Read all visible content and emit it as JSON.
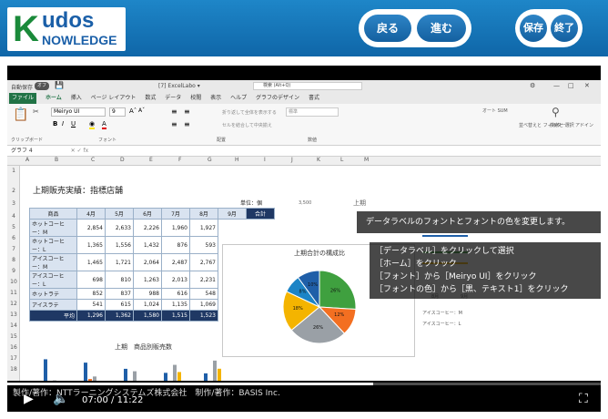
{
  "header": {
    "logo": {
      "k": "K",
      "udos": "udos",
      "nowledge": "NOWLEDGE"
    },
    "back_label": "戻る",
    "next_label": "進む",
    "save_label": "保存",
    "end_label": "終了"
  },
  "excel": {
    "autosave": "自動保存",
    "autosave_state": "オフ",
    "filename": "[7] ExcelLabo ▾",
    "search_placeholder": "検索 (Alt+Q)",
    "tabs": [
      "ファイル",
      "ホーム",
      "挿入",
      "ページ レイアウト",
      "数式",
      "データ",
      "校閲",
      "表示",
      "ヘルプ",
      "グラフのデザイン",
      "書式"
    ],
    "active_tab": "ホーム",
    "font_name": "Meiryo UI",
    "font_size": "9",
    "ribbon_groups": [
      "クリップボード",
      "フォント",
      "配置",
      "数値"
    ],
    "ribbon_items": [
      "折り返して全体を表示する",
      "セルを結合して中央揃え",
      "標準",
      "オート SUM",
      "並べ替えと フィルター",
      "検索と 選択",
      "アドイン"
    ],
    "namebox": "グラフ 4",
    "columns": [
      "A",
      "B",
      "C",
      "D",
      "E",
      "F",
      "G",
      "H",
      "I",
      "J",
      "K",
      "L",
      "M"
    ],
    "rows": [
      "1",
      "2",
      "3",
      "4",
      "5",
      "6",
      "7",
      "8",
      "9",
      "10",
      "11",
      "12",
      "13",
      "14",
      "15",
      "16",
      "17",
      "18"
    ],
    "sheet_title": "上期販売実績：指標店舗",
    "unit": "単位：個",
    "table_headers": [
      "商品",
      "4月",
      "5月",
      "6月",
      "7月",
      "8月",
      "9月",
      "合計"
    ],
    "table_rows": [
      [
        "ホットコーヒー：M",
        "2,854",
        "2,633",
        "2,226",
        "1,960",
        "1,927"
      ],
      [
        "ホットコーヒー：L",
        "1,365",
        "1,556",
        "1,432",
        "876",
        "593"
      ],
      [
        "アイスコーヒー：M",
        "1,465",
        "1,721",
        "2,064",
        "2,487",
        "2,767"
      ],
      [
        "アイスコーヒー：L",
        "698",
        "810",
        "1,263",
        "2,013",
        "2,231"
      ],
      [
        "ホットラテ",
        "852",
        "837",
        "988",
        "616",
        "548"
      ],
      [
        "アイスラテ",
        "541",
        "615",
        "1,024",
        "1,135",
        "1,069"
      ]
    ],
    "avg_row": [
      "平均",
      "1,296",
      "1,362",
      "1,580",
      "1,515",
      "1,523"
    ],
    "pie_title": "上期合計の構成比",
    "pie_labels": [
      {
        "name": "アイスラテ",
        "pct": "10%"
      },
      {
        "name": "ホットラテ",
        "pct": "8%"
      },
      {
        "name": "アイスコーヒー：L",
        "pct": "18%"
      },
      {
        "name": "アイスコーヒー：M",
        "pct": "26%"
      },
      {
        "name": "ホットコーヒー：L",
        "pct": "12%"
      },
      {
        "name": "ホットコーヒー：M",
        "pct": "26%"
      }
    ],
    "bottom_chart_title": "上期　商品別販売数",
    "right_chart_values": [
      "3,500",
      "3,000",
      "2,500",
      "2,000",
      "1,500",
      "1,000",
      "500",
      "0"
    ],
    "right_chart_months": [
      "8月",
      "9月"
    ],
    "right_chart_legend": [
      "アイスコーヒー：M",
      "アイスコーヒー：L"
    ],
    "right_chart_title_frag": "上期"
  },
  "overlay": {
    "callout": "データラベルのフォントとフォントの色を変更します。",
    "steps": [
      "［データラベル］をクリックして選択",
      "［ホーム］をクリック",
      "［フォント］から［Meiryo UI］をクリック",
      "［フォントの色］から［黒、テキスト1］をクリック"
    ],
    "watermark": "製作/著作：NTTラーニングシステムズ株式会社　制作/著作：BASIS Inc."
  },
  "player": {
    "current_time": "07:00",
    "duration": "11:22",
    "progress": 0.616
  },
  "chart_data": {
    "type": "pie",
    "title": "上期合計の構成比",
    "categories": [
      "ホットコーヒー：M",
      "ホットコーヒー：L",
      "アイスコーヒー：M",
      "アイスコーヒー：L",
      "ホットラテ",
      "アイスラテ"
    ],
    "values": [
      26,
      12,
      26,
      18,
      8,
      10
    ],
    "colors": [
      "#3fa03f",
      "#f36f21",
      "#9aa0a6",
      "#f4b400",
      "#1c84c6",
      "#1f5fa8"
    ]
  }
}
